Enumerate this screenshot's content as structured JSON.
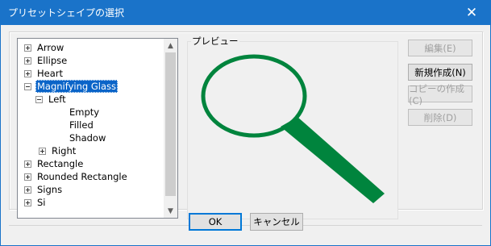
{
  "window": {
    "title": "プリセットシェイプの選択",
    "close_glyph": "✕"
  },
  "tree": {
    "items": [
      {
        "label": "Arrow",
        "expander": "plus"
      },
      {
        "label": "Ellipse",
        "expander": "plus"
      },
      {
        "label": "Heart",
        "expander": "plus"
      },
      {
        "label": "Magnifying Glass",
        "expander": "minus",
        "selected": true
      },
      {
        "label": "Left",
        "expander": "minus"
      },
      {
        "label": "Empty",
        "expander": "none"
      },
      {
        "label": "Filled",
        "expander": "none"
      },
      {
        "label": "Shadow",
        "expander": "none"
      },
      {
        "label": "Right",
        "expander": "plus"
      },
      {
        "label": "Rectangle",
        "expander": "plus"
      },
      {
        "label": "Rounded Rectangle",
        "expander": "plus"
      },
      {
        "label": "Signs",
        "expander": "plus"
      },
      {
        "label": "Si",
        "expander": "plus"
      }
    ]
  },
  "preview": {
    "label": "プレビュー",
    "shape_color": "#00843d"
  },
  "buttons": {
    "edit": "編集(E)",
    "new": "新規作成(N)",
    "copy": "コピーの作成(C)",
    "delete": "削除(D)",
    "ok": "OK",
    "cancel": "キャンセル"
  },
  "colors": {
    "titlebar": "#1a73c9",
    "selection": "#0a64c8",
    "shape": "#00843d"
  }
}
